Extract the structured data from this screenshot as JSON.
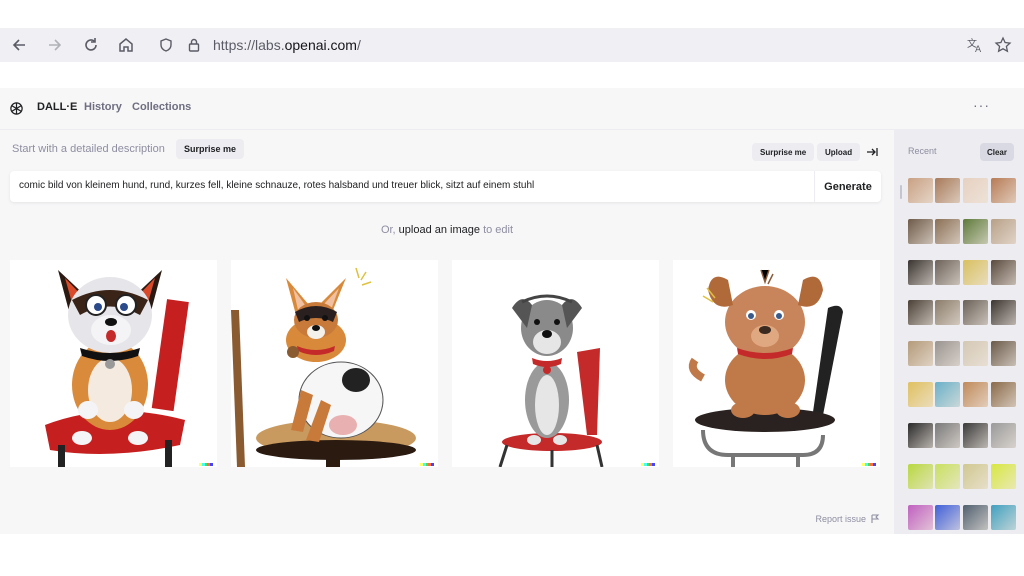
{
  "browser": {
    "url_prefix": "https://labs.",
    "url_domain": "openai.com",
    "url_suffix": "/"
  },
  "header": {
    "brand": "DALL·E",
    "nav": [
      "History",
      "Collections"
    ],
    "more": "···"
  },
  "prompt": {
    "label": "Start with a detailed description",
    "surprise_label": "Surprise me",
    "value": "comic bild von kleinem hund, rund, kurzes fell, kleine schnauze, rotes halsband und treuer blick, sitzt auf einem stuhl",
    "generate_label": "Generate"
  },
  "toolbar": {
    "surprise_label": "Surprise me",
    "upload_label": "Upload"
  },
  "upload_hint": {
    "prefix": "Or, ",
    "link": "upload an image",
    "suffix": " to edit"
  },
  "results": {
    "images": [
      {
        "name": "dog-image-1",
        "subject": "cartoon dog on red chair"
      },
      {
        "name": "dog-image-2",
        "subject": "terrier sitting on stool"
      },
      {
        "name": "dog-image-3",
        "subject": "schnauzer on red chair"
      },
      {
        "name": "dog-image-4",
        "subject": "brown puppy on metal chair"
      }
    ],
    "signature_colors": [
      "#ffff66",
      "#42ffff",
      "#51da4c",
      "#ff6e3c",
      "#3c46ff"
    ]
  },
  "footer": {
    "report_label": "Report issue"
  },
  "recent": {
    "label": "Recent",
    "clear_label": "Clear",
    "thumb_colors": [
      [
        "#c9a184",
        "#a77a5a",
        "#e6d1c1",
        "#b77b55"
      ],
      [
        "#6e5a48",
        "#8a6f55",
        "#5e7a3a",
        "#b8a088"
      ],
      [
        "#3a3430",
        "#6c625a",
        "#d8c060",
        "#5a4a3e"
      ],
      [
        "#4a4036",
        "#8a7c6a",
        "#6a6258",
        "#3c3430"
      ],
      [
        "#b49a7a",
        "#9a9490",
        "#d4c8b4",
        "#6a5a4a"
      ],
      [
        "#e0c060",
        "#6ab0c8",
        "#c08a5a",
        "#8a6a4a"
      ],
      [
        "#2a2a2a",
        "#7a7a7a",
        "#3a3a3a",
        "#9a9a9a"
      ],
      [
        "#b8d840",
        "#c8e060",
        "#d0c890",
        "#d8e840"
      ],
      [
        "#c060c0",
        "#4060d8",
        "#506070",
        "#40a0c0"
      ]
    ]
  }
}
